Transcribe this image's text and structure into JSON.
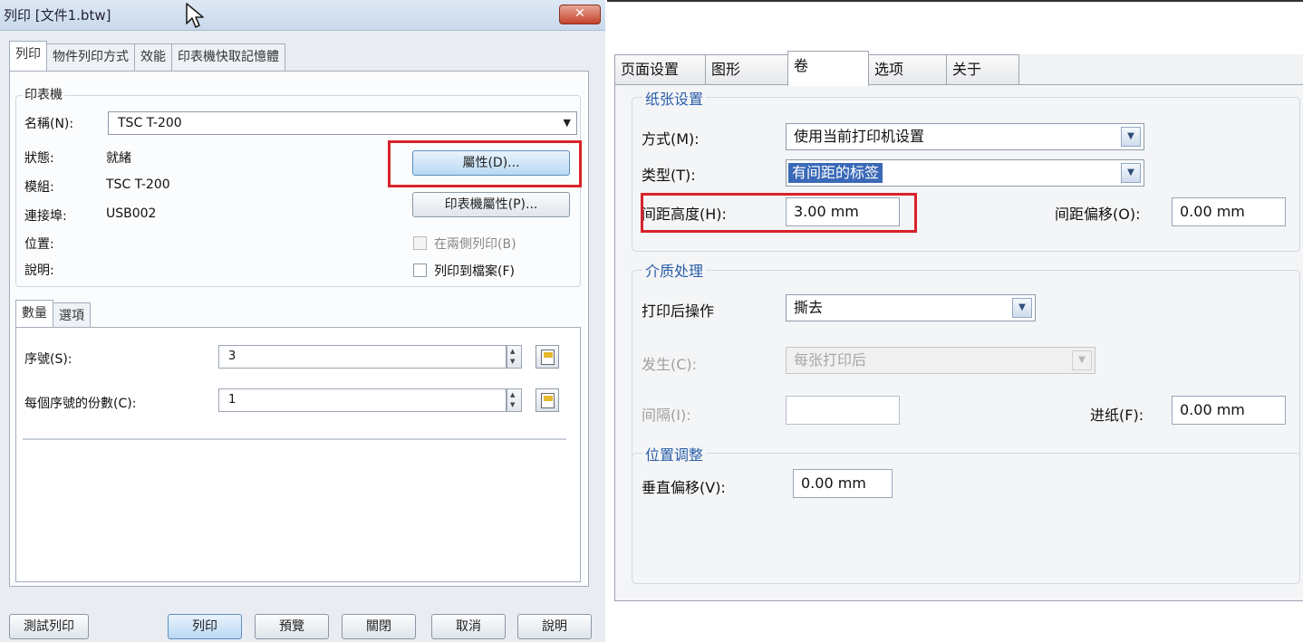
{
  "left_dialog": {
    "title": "列印 [文件1.btw]",
    "close": "✕",
    "tabs": [
      "列印",
      "物件列印方式",
      "效能",
      "印表機快取記憶體"
    ],
    "printer_group": {
      "label": "印表機",
      "name_label": "名稱(N):",
      "name_value": "TSC T-200",
      "status_label": "狀態:",
      "status_value": "就緒",
      "model_label": "模組:",
      "model_value": "TSC T-200",
      "port_label": "連接埠:",
      "port_value": "USB002",
      "location_label": "位置:",
      "comment_label": "說明:",
      "properties_button": "屬性(D)...",
      "printer_properties_button": "印表機屬性(P)...",
      "duplex_label": "在兩側列印(B)",
      "print_to_file_label": "列印到檔案(F)"
    },
    "sub_tabs": [
      "數量",
      "選項"
    ],
    "quantity": {
      "serial_label": "序號(S):",
      "serial_value": "3",
      "copies_label": "每個序號的份數(C):",
      "copies_value": "1"
    },
    "buttons": {
      "test_print": "測試列印",
      "print": "列印",
      "preview": "預覽",
      "close": "關閉",
      "cancel": "取消",
      "help": "說明"
    }
  },
  "right_dialog": {
    "tabs": [
      "页面设置",
      "图形",
      "卷",
      "选项",
      "关于"
    ],
    "paper_group": {
      "label": "纸张设置",
      "method_label": "方式(M):",
      "method_value": "使用当前打印机设置",
      "type_label": "类型(T):",
      "type_value": "有间距的标签",
      "gap_height_label": "间距高度(H):",
      "gap_height_value": "3.00 mm",
      "gap_offset_label": "间距偏移(O):",
      "gap_offset_value": "0.00 mm"
    },
    "media_group": {
      "label": "介质处理",
      "after_print_label": "打印后操作",
      "after_print_value": "撕去",
      "occur_label": "发生(C):",
      "occur_value": "每张打印后",
      "interval_label": "间隔(I):",
      "interval_value": "",
      "feed_label": "进纸(F):",
      "feed_value": "0.00 mm"
    },
    "position_group": {
      "label": "位置调整",
      "vertical_offset_label": "垂直偏移(V):",
      "vertical_offset_value": "0.00 mm"
    }
  },
  "colors": {
    "highlight_red": "#d8232a",
    "group_label_blue": "#2b5ea8",
    "selection_blue": "#3a69b7"
  },
  "icons": [
    "cursor-icon",
    "close-icon",
    "dropdown-arrow-icon",
    "spin-icon",
    "document-icon"
  ]
}
